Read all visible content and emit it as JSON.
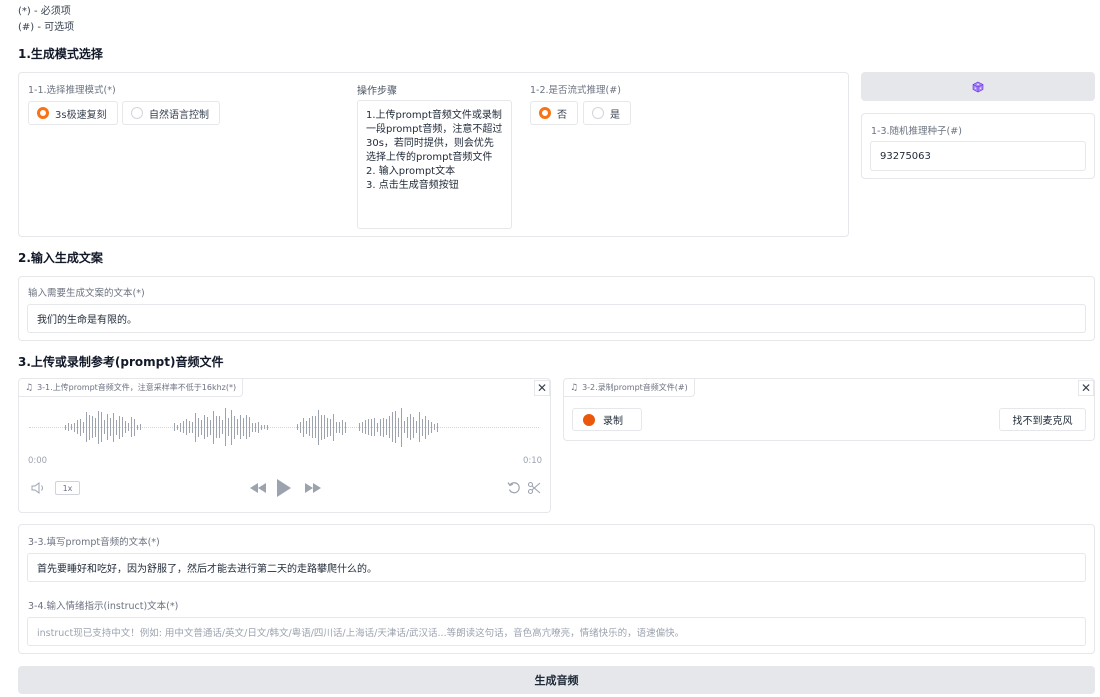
{
  "legend": {
    "required": "(*) - 必须项",
    "optional": "(#) - 可选项"
  },
  "section1": {
    "title": "1.生成模式选择",
    "mode": {
      "label": "1-1.选择推理模式(*)",
      "options": [
        "3s极速复刻",
        "自然语言控制"
      ],
      "selected": 0
    },
    "steps": {
      "label": "操作步骤",
      "lines": [
        "1.上传prompt音频文件或录制一段prompt音频，注意不超过30s，若同时提供，则会优先选择上传的prompt音频文件",
        "2. 输入prompt文本",
        "3. 点击生成音频按钮"
      ]
    },
    "stream": {
      "label": "1-2.是否流式推理(#)",
      "options": [
        "否",
        "是"
      ],
      "selected": 0
    },
    "dice_icon": "dice-icon",
    "seed": {
      "label": "1-3.随机推理种子(#)",
      "value": "93275063"
    }
  },
  "section2": {
    "title": "2.输入生成文案",
    "label": "输入需要生成文案的文本(*)",
    "value": "我们的生命是有限的。"
  },
  "section3": {
    "title": "3.上传或录制参考(prompt)音频文件",
    "upload": {
      "label": "3-1.上传prompt音频文件，注意采样率不低于16khz(*)",
      "time_start": "0:00",
      "time_end": "0:10",
      "speed": "1x"
    },
    "record": {
      "label": "3-2.录制prompt音频文件(#)",
      "record_label": "录制",
      "mic_status": "找不到麦克风"
    },
    "prompt_text": {
      "label": "3-3.填写prompt音频的文本(*)",
      "value": "首先要睡好和吃好，因为舒服了，然后才能去进行第二天的走路攀爬什么的。"
    },
    "instruct": {
      "label": "3-4.输入情绪指示(instruct)文本(*)",
      "placeholder": "instruct现已支持中文！例如: 用中文普通话/英文/日文/韩文/粤语/四川话/上海话/天津话/武汉话...等朗读这句话，音色高亢嘹亮，情绪快乐的，语速偏快。"
    }
  },
  "generate_label": "生成音频"
}
